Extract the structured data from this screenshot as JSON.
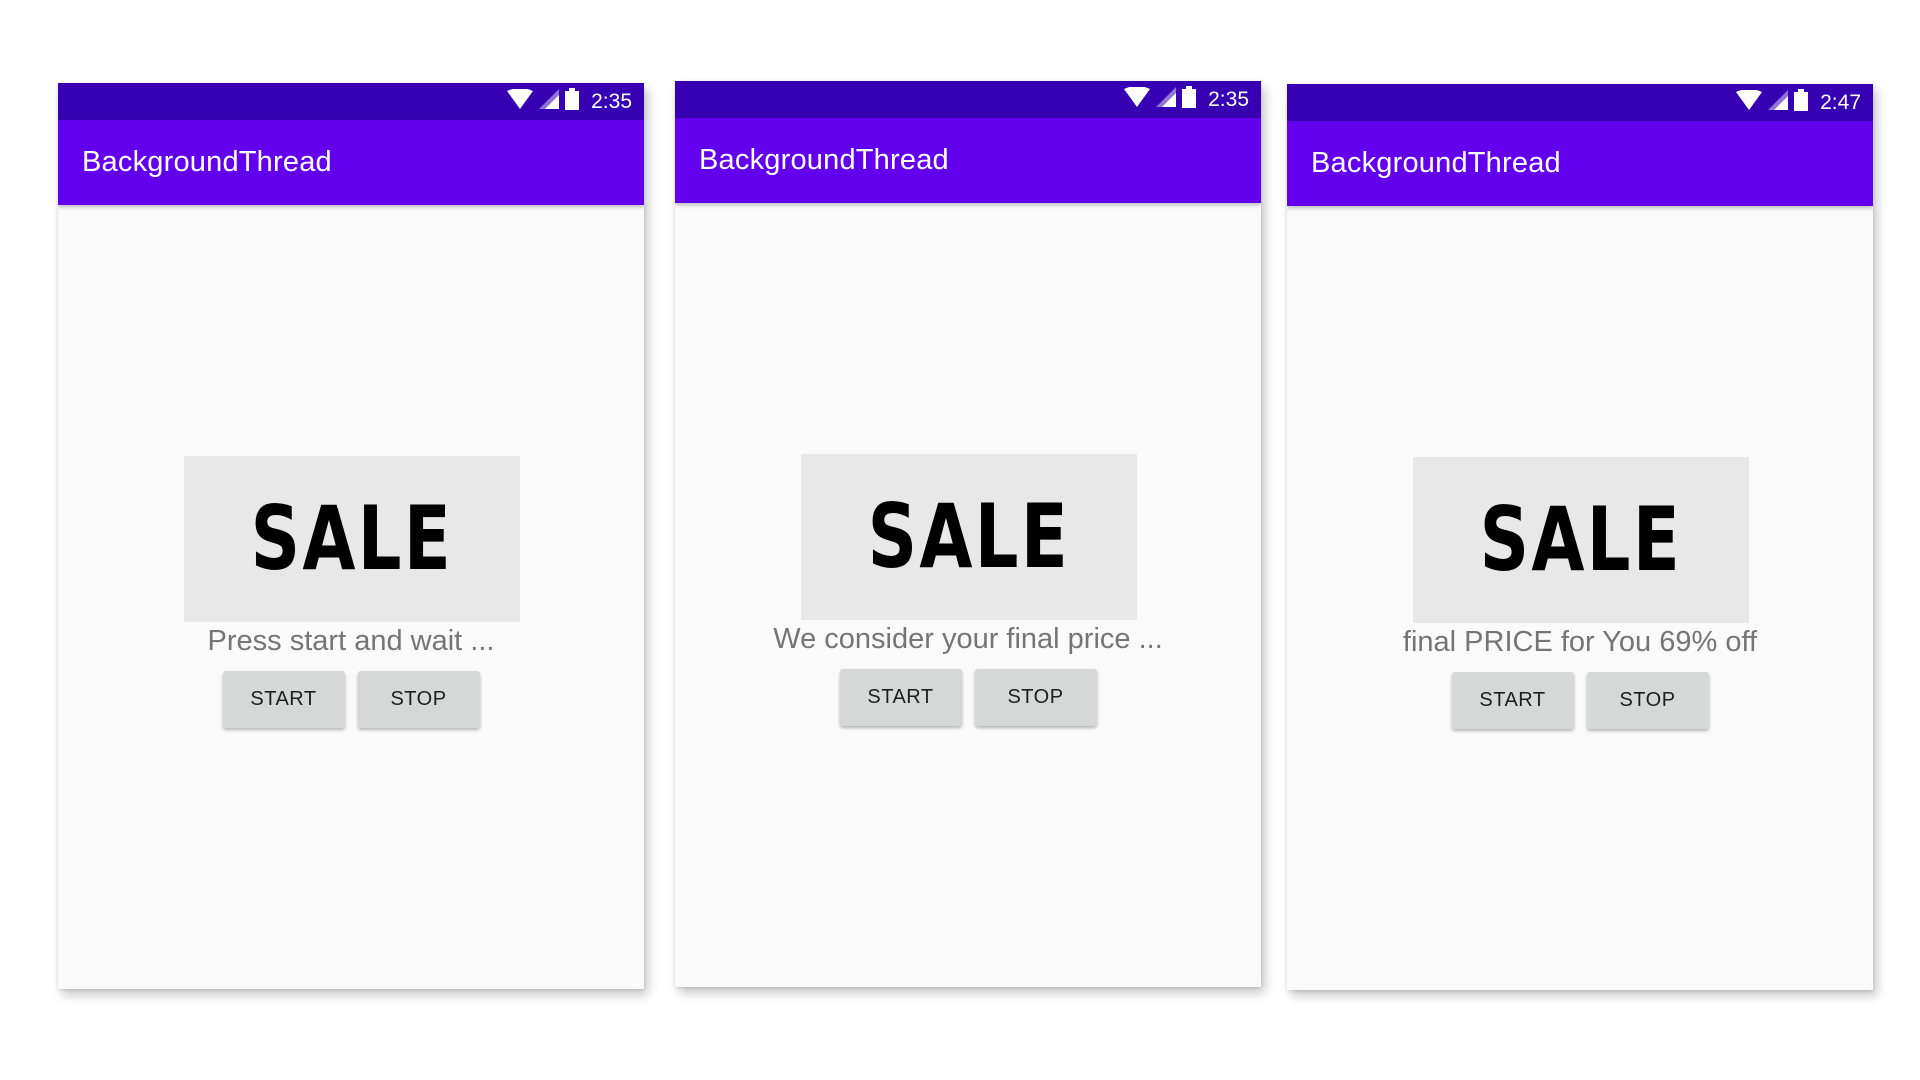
{
  "screens": [
    {
      "status_time": "2:35",
      "app_title": "BackgroundThread",
      "sale_label": "SALE",
      "message": "Press start and wait ...",
      "start_label": "START",
      "stop_label": "STOP"
    },
    {
      "status_time": "2:35",
      "app_title": "BackgroundThread",
      "sale_label": "SALE",
      "message": "We consider your final price ...",
      "start_label": "START",
      "stop_label": "STOP"
    },
    {
      "status_time": "2:47",
      "app_title": "BackgroundThread",
      "sale_label": "SALE",
      "message": "final PRICE for You 69% off",
      "start_label": "START",
      "stop_label": "STOP"
    }
  ],
  "icons": {
    "wifi": "wifi-icon",
    "signal": "cell-signal-icon",
    "battery": "battery-icon"
  },
  "colors": {
    "status_bar": "#3700b3",
    "app_bar": "#6200ee",
    "background": "#fafafa",
    "sale_box": "#e8e8e8",
    "message_text": "#757575",
    "button": "#d6d7d7"
  }
}
